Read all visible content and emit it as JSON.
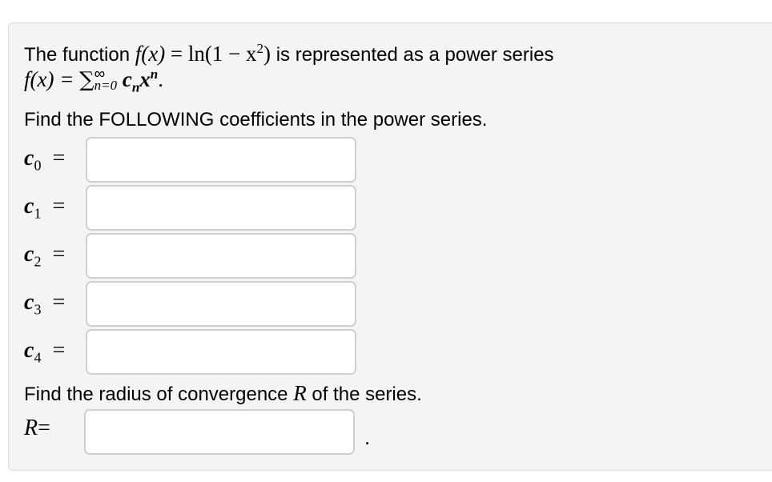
{
  "problem": {
    "intro_text": "The function",
    "func_lhs": "f(x)",
    "equals": "=",
    "func_rhs_ln": "ln(1 − x",
    "func_rhs_exp": "2",
    "func_rhs_close": ")",
    "intro_suffix": "is represented as a power series",
    "series_lhs": "f(x) =",
    "series_sum": "∑",
    "series_upper": "∞",
    "series_lower": "n=0",
    "series_term_c": "c",
    "series_term_c_sub": "n",
    "series_term_x": "x",
    "series_term_x_sup": "n",
    "series_end": ".",
    "instruction_1": "Find the FOLLOWING coefficients in the power series.",
    "instruction_2_pre": "Find the radius of convergence",
    "instruction_2_var": "R",
    "instruction_2_post": "of the series."
  },
  "coefficients": [
    {
      "symbol": "c",
      "index": "0",
      "eq": "=",
      "value": ""
    },
    {
      "symbol": "c",
      "index": "1",
      "eq": "=",
      "value": ""
    },
    {
      "symbol": "c",
      "index": "2",
      "eq": "=",
      "value": ""
    },
    {
      "symbol": "c",
      "index": "3",
      "eq": "=",
      "value": ""
    },
    {
      "symbol": "c",
      "index": "4",
      "eq": "=",
      "value": ""
    }
  ],
  "radius": {
    "symbol": "R",
    "eq": "=",
    "value": "",
    "trailing": "."
  }
}
